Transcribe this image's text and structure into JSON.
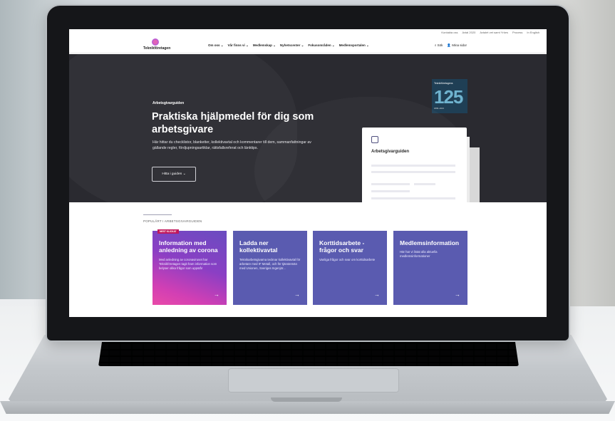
{
  "site": {
    "utility_links": [
      "Kontakta oss",
      "Avtal 2020",
      "Avtalet vet samt Yrkes",
      "Process",
      "In English"
    ],
    "logo_text": "Teknikföretagen",
    "menu": [
      "Om oss ⌄",
      "Vår finns vi ⌄",
      "Medlemskap ⌄",
      "Nyhetscenter ⌄",
      "Fokusområden ⌄",
      "Medlemsportalen ⌄"
    ],
    "search_label": "⌕ Sök",
    "account_label": "👤 Mina sidor"
  },
  "hero": {
    "eyebrow": "Arbetsgivarguiden",
    "title": "Praktiska hjälpmedel för dig som arbetsgivare",
    "description": "Här hittar du checklistor, blanketter, kollektivavtal och kommentarer till dem, sammanfattningar av gällande regler, fördjupningsartiklar, rättsfallsreferat och länktips.",
    "button_label": "Hitta i guiden ⌄",
    "card_title": "Arbetsgivarguiden",
    "badge": {
      "top": "Teknikföretagens",
      "number": "125",
      "sub": "1896–2021"
    }
  },
  "popular": {
    "label": "POPULÄRT I ARBETSGIVARGUIDEN",
    "tiles": [
      {
        "badge": "MEST KLICKAT",
        "title": "Information med anledning av corona",
        "text": "Med anledning av coronaviruset har Teknikföretagen tagit fram information som belyser olika frågor som uppstår"
      },
      {
        "title": "Ladda ner kollektivavtal",
        "text": "Teknikarbetsgivarna tecknar kollektivavtal för arbetare med IF Metall, och för tjänstemän med Unionen, Sveriges Ingenjör..."
      },
      {
        "title": "Korttidsarbete - frågor och svar",
        "text": "Vanliga frågor och svar om korttidsarbete"
      },
      {
        "title": "Medlemsinformation",
        "text": "Här har vi listat alla aktuella medlemsinformationer"
      }
    ],
    "arrow": "→"
  },
  "colors": {
    "hero_bg": "#2a2a30",
    "tile_purple": "#5a5bb0",
    "featured_pink": "#d23fb4"
  }
}
